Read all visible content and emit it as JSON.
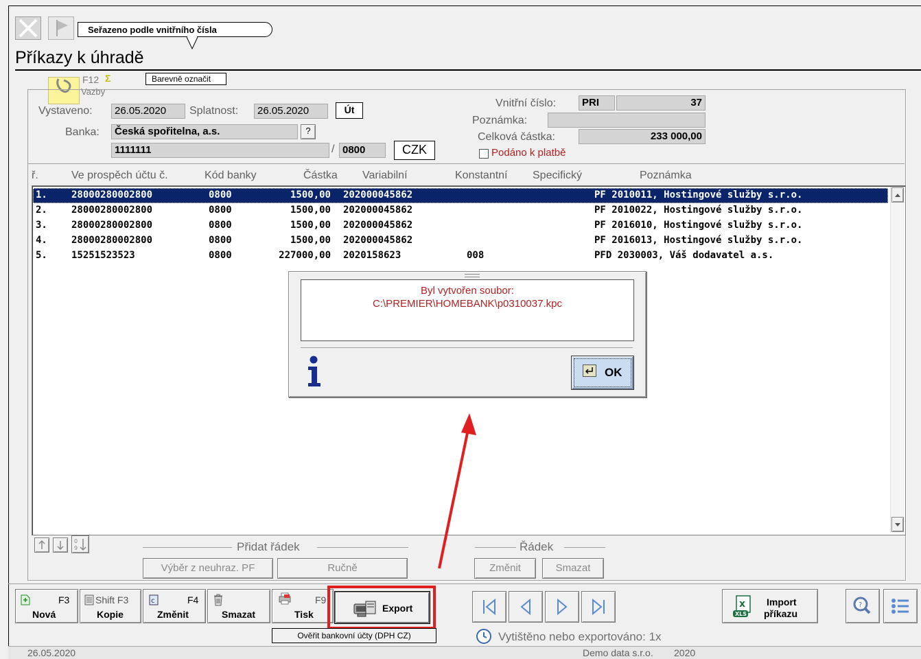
{
  "toolbar_tooltip": "Seřazeno podle vnitřního čísla",
  "page_title": "Příkazy k úhradě",
  "fkey": {
    "f12": "F12",
    "vazby": "Vazby",
    "color_tooltip": "Barevně označit"
  },
  "form": {
    "vystaveno_label": "Vystaveno:",
    "vystaveno": "26.05.2020",
    "splatnost_label": "Splatnost:",
    "splatnost": "26.05.2020",
    "day": "Út",
    "banka_label": "Banka:",
    "banka": "Česká spořitelna, a.s.",
    "banka_btn": "?",
    "account": "1111111",
    "slash": "/",
    "bank_code": "0800",
    "currency": "CZK",
    "vnitrni_label": "Vnitřní číslo:",
    "vnitrni_prefix": "PRI",
    "vnitrni_number": "37",
    "poznamka_label": "Poznámka:",
    "poznamka": "",
    "celkova_label": "Celková částka:",
    "celkova": "233 000,00",
    "podano_label": "Podáno k platbě"
  },
  "columns": [
    "ř.",
    "Ve prospěch účtu č.",
    "Kód banky",
    "Částka",
    "Variabilní",
    "Konstantní",
    "Specifický",
    "Poznámka"
  ],
  "rows": [
    {
      "n": "1.",
      "account": "28000280002800",
      "bank": "0800",
      "amount": "1500,00",
      "var": "202000045862",
      "const": "",
      "spec": "",
      "note": "PF 2010011, Hostingové služby s.r.o."
    },
    {
      "n": "2.",
      "account": "28000280002800",
      "bank": "0800",
      "amount": "1500,00",
      "var": "202000045862",
      "const": "",
      "spec": "",
      "note": "PF 2010022, Hostingové služby s.r.o."
    },
    {
      "n": "3.",
      "account": "28000280002800",
      "bank": "0800",
      "amount": "1500,00",
      "var": "202000045862",
      "const": "",
      "spec": "",
      "note": "PF 2016010, Hostingové služby s.r.o."
    },
    {
      "n": "4.",
      "account": "28000280002800",
      "bank": "0800",
      "amount": "1500,00",
      "var": "202000045862",
      "const": "",
      "spec": "",
      "note": "PF 2016013, Hostingové služby s.r.o."
    },
    {
      "n": "5.",
      "account": "15251523523",
      "bank": "0800",
      "amount": "227000,00",
      "var": "2020158623",
      "const": "008",
      "spec": "",
      "note": "PFD 2030003, Váš dodavatel a.s."
    }
  ],
  "dialog": {
    "line1": "Byl vytvořen soubor:",
    "line2": "C:\\PREMIER\\HOMEBANK\\p0310037.kpc",
    "ok": "OK"
  },
  "grid_actions": {
    "pridat_radek": "Přidat řádek",
    "vyber": "Výběr z neuhraz. PF",
    "rucne": "Ručně",
    "radek": "Řádek",
    "zmenit": "Změnit",
    "smazat": "Smazat"
  },
  "bottom": {
    "nova_key": "F3",
    "nova": "Nová",
    "kopie_key": "Shift F3",
    "kopie": "Kopie",
    "zmenit_key": "F4",
    "zmenit": "Změnit",
    "smazat": "Smazat",
    "tisk_key": "F9",
    "tisk": "Tisk",
    "export": "Export",
    "overit": "Ověřit bankovní účty (DPH CZ)",
    "import_line1": "Import",
    "import_line2": "příkazu",
    "printed": "Vytištěno nebo exportováno: 1x"
  },
  "status": {
    "date": "26.05.2020",
    "company": "Demo data s.r.o.",
    "year": "2020"
  },
  "colors": {
    "selection": "#0a246a",
    "dialog_text": "#b22222",
    "highlight": "#e02020",
    "ok_bg": "#c9dcf2"
  }
}
